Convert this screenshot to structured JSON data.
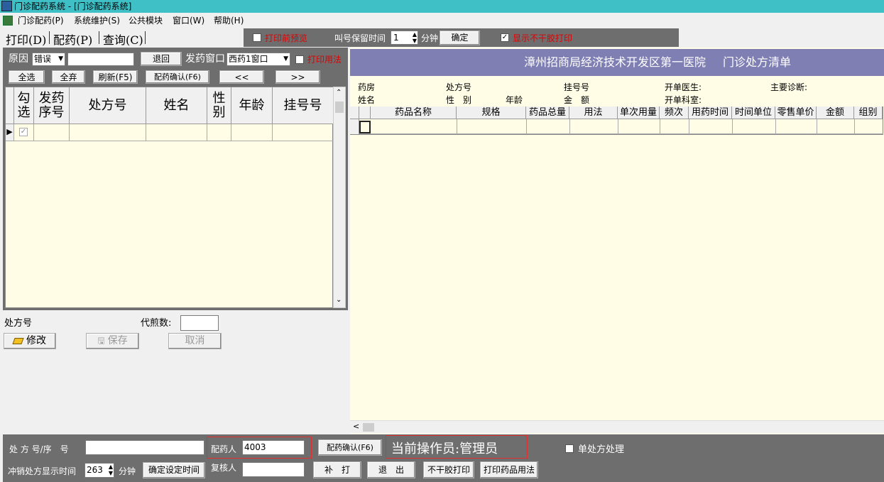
{
  "window": {
    "title": "门诊配药系统 - [门诊配药系统]"
  },
  "menu": [
    "门诊配药(P)",
    "系统维护(S)",
    "公共模块",
    "窗口(W)",
    "帮助(H)"
  ],
  "tabs": [
    "打印(D)",
    "配药(P)",
    "查询(C)"
  ],
  "topbar": {
    "print_preview": "打印前预览",
    "call_retain_label": "叫号保留时间",
    "call_retain_value": "1",
    "minutes": "分钟",
    "confirm": "确定",
    "hide_dry_print": "显示不干胶打印"
  },
  "left": {
    "reason_label": "原因",
    "reason_value": "错误",
    "return_btn": "退回",
    "window_label": "发药窗口",
    "window_value": "西药1窗口",
    "print_usage": "打印用法",
    "select_all": "全选",
    "discard_all": "全弃",
    "refresh": "刷新(F5)",
    "dispense_confirm": "配药确认(F6)",
    "prev": "<<",
    "next": ">>"
  },
  "grid_headers": [
    "勾选",
    "发药序号",
    "处方号",
    "姓名",
    "性别",
    "年龄",
    "挂号号"
  ],
  "below_grid": {
    "rx_label": "处方号",
    "decoct_label": "代煎数:",
    "modify": "修改",
    "save": "保存",
    "cancel": "取消"
  },
  "right": {
    "hospital": "漳州招商局经济技术开发区第一医院",
    "list_title": "门诊处方清单",
    "info_row1": [
      "药房",
      "处方号",
      "挂号号",
      "开单医生:",
      "主要诊断:"
    ],
    "info_row2": [
      "姓名",
      "性　别",
      "年龄",
      "金　额",
      "开单科室:"
    ],
    "columns": [
      "药品名称",
      "规格",
      "药品总量",
      "用法",
      "单次用量",
      "频次",
      "用药时间",
      "时间单位",
      "零售单价",
      "金额",
      "组别"
    ]
  },
  "bottom": {
    "rx_seq_label": "处 方 号/序　号",
    "dispenser_label": "配药人",
    "dispenser_value": "4003",
    "dispense_confirm": "配药确认(F6)",
    "operator": "当前操作员:管理员",
    "single_rx": "单处方处理",
    "cancel_time_label": "冲销处方显示时间",
    "cancel_time_value": "263",
    "minutes": "分钟",
    "set_time": "确定设定时间",
    "reviewer_label": "复核人",
    "reprint": "补　打",
    "exit": "退　出",
    "no_dry_print": "不干胶打印",
    "print_usage": "打印药品用法"
  }
}
